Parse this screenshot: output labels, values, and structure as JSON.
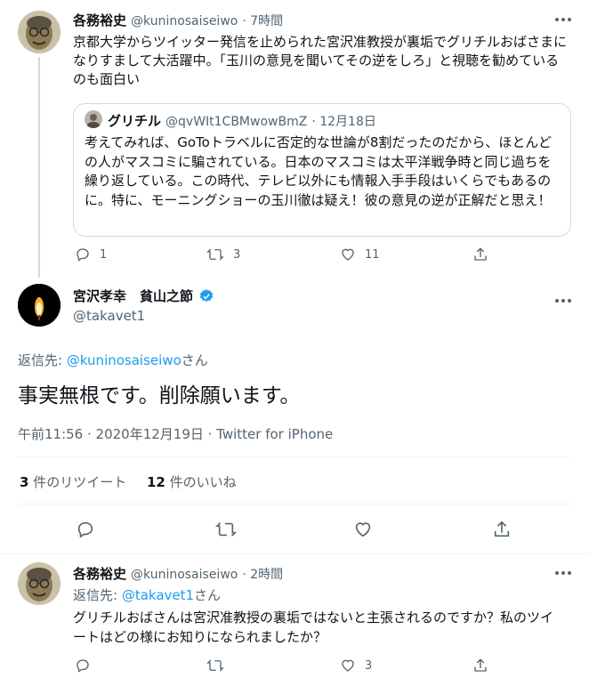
{
  "tweet1": {
    "name": "各務裕史",
    "handle": "@kuninosaiseiwo",
    "time": "· 7時間",
    "body": "京都大学からツイッター発信を止められた宮沢准教授が裏垢でグリチルおばさまになりすまして大活躍中。「玉川の意見を聞いてその逆をしろ」と視聴を勧めているのも面白い",
    "actions": {
      "reply": "1",
      "retweet": "3",
      "like": "11",
      "share": ""
    }
  },
  "quote": {
    "name": "グリチル",
    "handle": "@qvWIt1CBMwowBmZ",
    "time": "· 12月18日",
    "body": "考えてみれば、GoToトラベルに否定的な世論が8割だったのだから、ほとんどの人がマスコミに騙されている。日本のマスコミは太平洋戦争時と同じ過ちを繰り返している。この時代、テレビ以外にも情報入手手段はいくらでもあるのに。特に、モーニングショーの玉川徹は疑え！彼の意見の逆が正解だと思え！"
  },
  "main": {
    "name": "宮沢孝幸　貧山之節",
    "handle": "@takavet1",
    "reply_prefix": "返信先: ",
    "reply_to": "@kuninosaiseiwo",
    "reply_suffix": "さん",
    "body": "事実無根です。削除願います。",
    "meta": "午前11:56 · 2020年12月19日 · Twitter for iPhone",
    "retweet_count": "3",
    "retweet_label": " 件のリツイート",
    "like_count": "12",
    "like_label": " 件のいいね"
  },
  "tweet3": {
    "name": "各務裕史",
    "handle": "@kuninosaiseiwo",
    "time": "· 2時間",
    "reply_prefix": "返信先: ",
    "reply_to": "@takavet1",
    "reply_suffix": "さん",
    "body": "グリチルおばさんは宮沢准教授の裏垢ではないと主張されるのですか？私のツイートはどの様にお知りになられましたか？",
    "actions": {
      "reply": "",
      "retweet": "",
      "like": "3",
      "share": ""
    }
  },
  "colors": {
    "accent": "#1d9bf0",
    "secondary_text": "#536471",
    "verified": "#1d9bf0"
  },
  "icons": [
    "reply-icon",
    "retweet-icon",
    "like-icon",
    "share-icon",
    "more-icon",
    "verified-icon"
  ]
}
